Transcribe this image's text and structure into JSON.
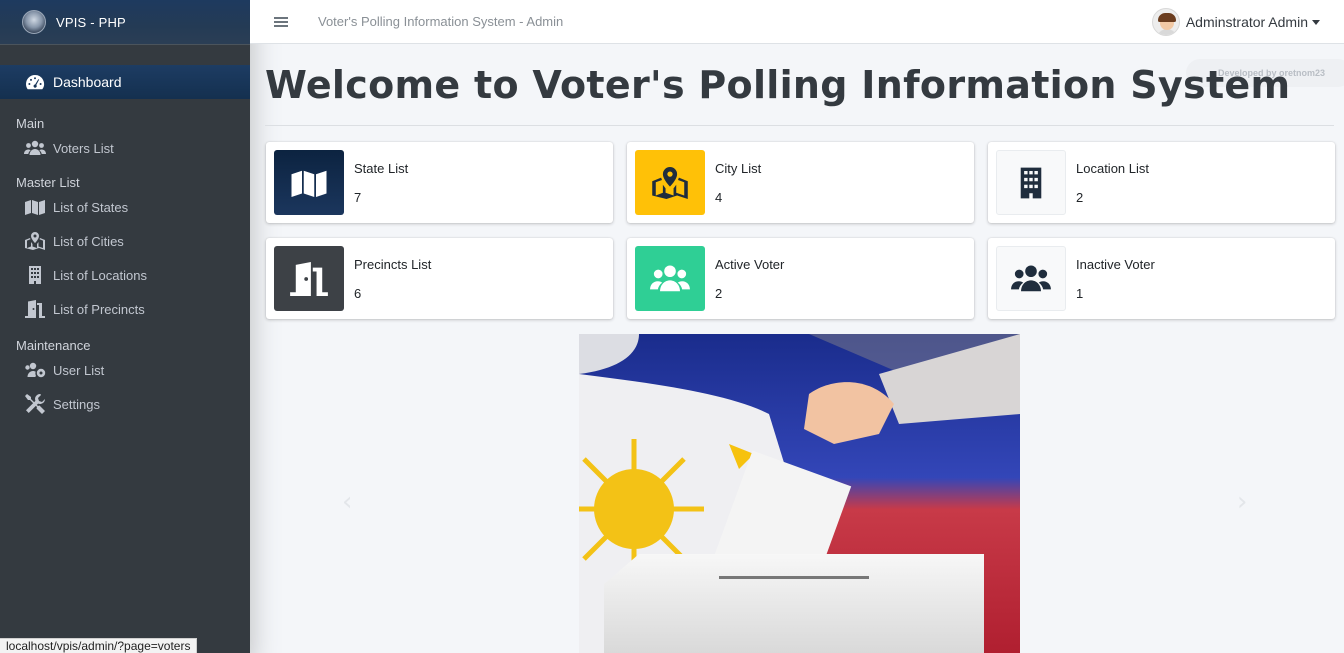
{
  "brand": {
    "name": "VPIS - PHP"
  },
  "sidebar": {
    "active": {
      "label": "Dashboard",
      "icon": "tachometer-icon"
    },
    "sections": [
      {
        "header": "Main",
        "items": [
          {
            "label": "Voters List",
            "icon": "users-icon"
          }
        ]
      },
      {
        "header": "Master List",
        "items": [
          {
            "label": "List of States",
            "icon": "map-icon"
          },
          {
            "label": "List of Cities",
            "icon": "map-marked-icon"
          },
          {
            "label": "List of Locations",
            "icon": "building-icon"
          },
          {
            "label": "List of Precincts",
            "icon": "door-open-icon"
          }
        ]
      },
      {
        "header": "Maintenance",
        "items": [
          {
            "label": "User List",
            "icon": "users-cog-icon"
          },
          {
            "label": "Settings",
            "icon": "tools-icon"
          }
        ]
      }
    ]
  },
  "topbar": {
    "title": "Voter's Polling Information System - Admin",
    "user_name": "Adminstrator Admin"
  },
  "dev_badge": "Developed by oretnom23",
  "page_title": "Welcome to Voter's Polling Information System",
  "cards": [
    {
      "label": "State List",
      "value": "7",
      "icon": "map-icon",
      "color": "#0c2340"
    },
    {
      "label": "City List",
      "value": "4",
      "icon": "map-marked-icon",
      "color": "#ffc107"
    },
    {
      "label": "Location List",
      "value": "2",
      "icon": "building-icon",
      "color": "#f8f9fa"
    },
    {
      "label": "Precincts List",
      "value": "6",
      "icon": "door-open-icon",
      "color": "#3d4146"
    },
    {
      "label": "Active Voter",
      "value": "2",
      "icon": "users-icon",
      "color": "#2fcf95"
    },
    {
      "label": "Inactive Voter",
      "value": "1",
      "icon": "users-icon",
      "color": "#f8f9fa"
    }
  ],
  "carousel": {
    "prev": "‹",
    "next": "›"
  },
  "status_bar": "localhost/vpis/admin/?page=voters"
}
